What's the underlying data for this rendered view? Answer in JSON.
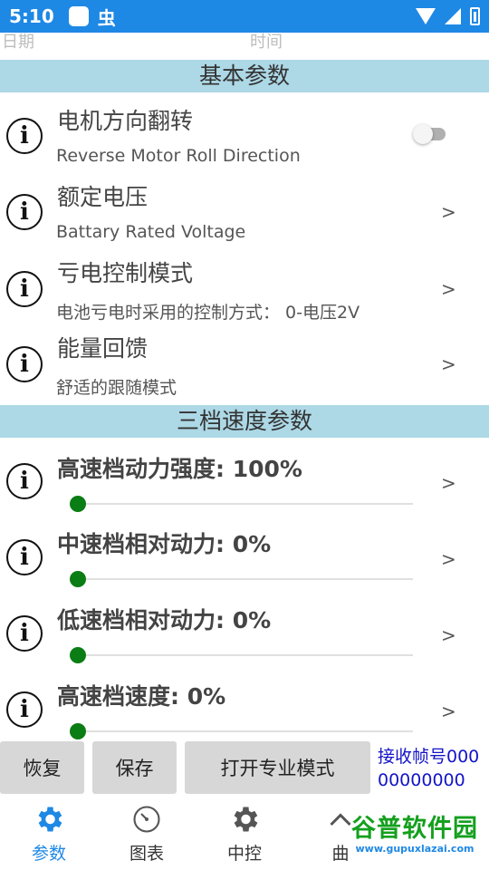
{
  "status_bar": {
    "time": "5:10",
    "notification_glyph": "虫"
  },
  "column_headers": {
    "date": "日期",
    "time": "时间"
  },
  "sections": [
    {
      "label": "基本参数"
    },
    {
      "label": "三档速度参数"
    }
  ],
  "basic_params": [
    {
      "title": "电机方向翻转",
      "subtitle": "Reverse Motor Roll Direction",
      "control": "toggle",
      "toggle_on": false
    },
    {
      "title": "额定电压",
      "subtitle": "Battary Rated Voltage",
      "chevron": ">"
    },
    {
      "title": "亏电控制模式",
      "subtitle": "电池亏电时采用的控制方式：  0-电压2V",
      "chevron": ">"
    },
    {
      "title": "能量回馈",
      "subtitle": "舒适的跟随模式",
      "chevron": ">"
    }
  ],
  "speed_params": [
    {
      "title": "高速档动力强度: 100%",
      "slider_value": 0,
      "chevron": ">"
    },
    {
      "title": "中速档相对动力: 0%",
      "slider_value": 0,
      "chevron": ">"
    },
    {
      "title": "低速档相对动力: 0%",
      "slider_value": 0,
      "chevron": ">"
    },
    {
      "title": "高速档速度: 0%",
      "slider_value": 0,
      "chevron": ">"
    }
  ],
  "info_glyph": "i",
  "buttons": {
    "restore": "恢复",
    "save": "保存",
    "pro_mode": "打开专业模式"
  },
  "frame_counter": "接收帧号00000000000",
  "bottom_nav": [
    {
      "label": "参数",
      "icon": "gear-icon",
      "active": true
    },
    {
      "label": "图表",
      "icon": "gauge-icon",
      "active": false
    },
    {
      "label": "中控",
      "icon": "gear-icon",
      "active": false
    },
    {
      "label": "曲",
      "icon": "chevron-up-icon",
      "active": false
    }
  ],
  "watermark": {
    "text": "谷普软件园",
    "url": "www.gupuxlazai.com"
  },
  "colors": {
    "status_bar": "#1e88e5",
    "section_bg": "#add8e6",
    "slider_knob": "#0a7d14",
    "frame_text": "#1414c8",
    "active_nav": "#1e88e5"
  }
}
